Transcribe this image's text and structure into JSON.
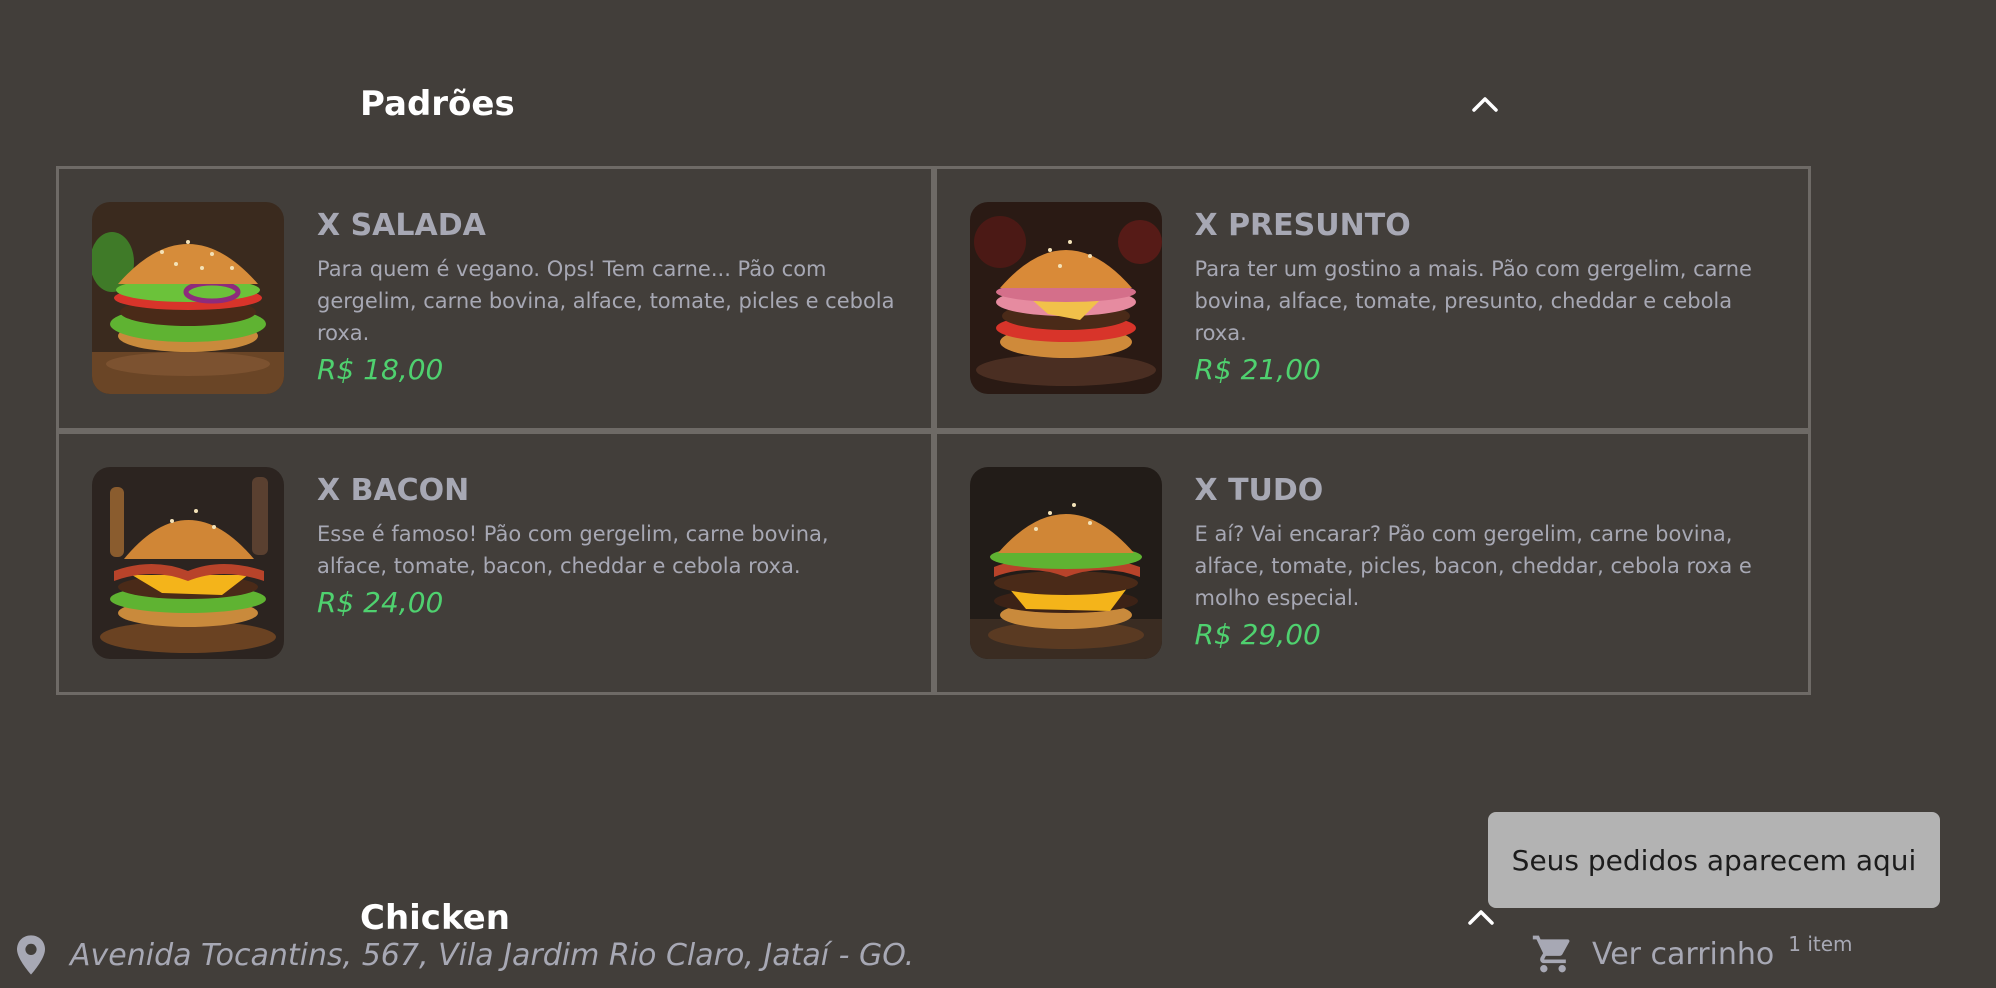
{
  "sections": [
    {
      "title": "Padrões",
      "items": [
        {
          "name": "X SALADA",
          "description": "Para quem é vegano. Ops! Tem carne... Pão com gergelim, carne bovina, alface, tomate, picles e cebola roxa.",
          "price": "R$ 18,00"
        },
        {
          "name": "X PRESUNTO",
          "description": "Para ter um gostino a mais. Pão com gergelim, carne bovina, alface, tomate, presunto, cheddar e cebola roxa.",
          "price": "R$ 21,00"
        },
        {
          "name": "X BACON",
          "description": "Esse é famoso! Pão com gergelim, carne bovina, alface, tomate, bacon, cheddar e cebola roxa.",
          "price": "R$ 24,00"
        },
        {
          "name": "X TUDO",
          "description": "E aí? Vai encarar? Pão com gergelim, carne bovina, alface, tomate, picles, bacon, cheddar, cebola roxa e molho especial.",
          "price": "R$ 29,00"
        }
      ]
    },
    {
      "title": "Chicken"
    }
  ],
  "toast": {
    "text": "Seus pedidos aparecem aqui"
  },
  "footer": {
    "address": "Avenida Tocantins, 567, Vila Jardim Rio Claro, Jataí - GO.",
    "cart_label": "Ver carrinho",
    "cart_count": "1 item",
    "icons": [
      "location-pin-icon",
      "cart-icon",
      "chevron-up-icon"
    ]
  },
  "colors": {
    "background": "#423e3a",
    "price": "#4fd16f",
    "muted_text": "#a7a8b4",
    "card_border": "#6e6a66",
    "toast_bg": "#b3b3b3"
  }
}
